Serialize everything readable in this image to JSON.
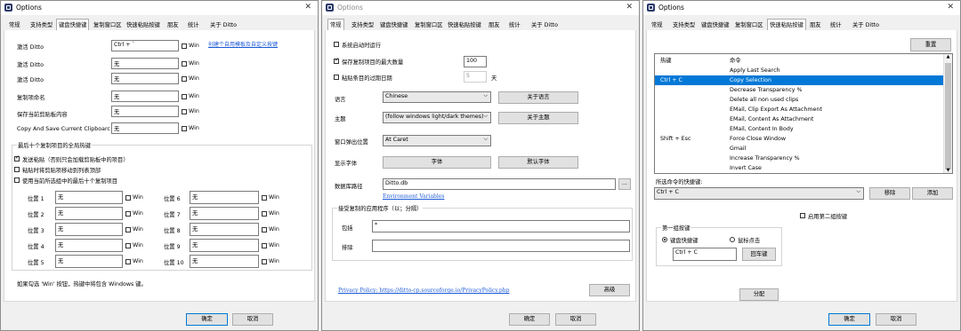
{
  "w1": {
    "title": "Options",
    "tabs": [
      "常规",
      "支持类型",
      "键盘快捷键",
      "复制窗口区",
      "快速粘贴按键",
      "朋友",
      "统计",
      "关于 Ditto"
    ],
    "top_hotkeys": [
      {
        "label": "激活 Ditto",
        "value": "Ctrl + `"
      },
      {
        "label": "激活 Ditto",
        "value": "无"
      },
      {
        "label": "激活 Ditto",
        "value": "无"
      },
      {
        "label": "复制项命名",
        "value": "无"
      },
      {
        "label": "保存当前剪贴板内容",
        "value": "无"
      },
      {
        "label": "Copy And Save Current Clipboarc",
        "value": "无"
      }
    ],
    "win_label": "Win",
    "link": "创建个自用模板及自定义按键",
    "group_title": "最后十个复制项目的全局热键",
    "checks": [
      {
        "label": "发送粘贴（否则只会加载剪贴板中的项目）",
        "checked": true
      },
      {
        "label": "粘贴时将剪贴项移动到列表顶部",
        "checked": false
      },
      {
        "label": "使用当前所选组中的最后十个复制项目",
        "checked": false
      }
    ],
    "positions_left": [
      {
        "label": "位置 1",
        "value": "无"
      },
      {
        "label": "位置 2",
        "value": "无"
      },
      {
        "label": "位置 3",
        "value": "无"
      },
      {
        "label": "位置 4",
        "value": "无"
      },
      {
        "label": "位置 5",
        "value": "无"
      }
    ],
    "positions_right": [
      {
        "label": "位置 6",
        "value": "无"
      },
      {
        "label": "位置 7",
        "value": "无"
      },
      {
        "label": "位置 8",
        "value": "无"
      },
      {
        "label": "位置 9",
        "value": "无"
      },
      {
        "label": "位置 10",
        "value": "无"
      }
    ],
    "note": "如果勾选 'Win' 按钮，热键中将包含 Windows 键。",
    "ok": "确定",
    "cancel": "取消"
  },
  "w2": {
    "title": "Options",
    "tabs": [
      "常规",
      "支持类型",
      "键盘快捷键",
      "复制窗口区",
      "快速粘贴按键",
      "朋友",
      "统计",
      "关于 Ditto"
    ],
    "startup": "系统启动时运行",
    "save_max": "保存复制项目的最大数量",
    "save_max_value": "100",
    "expire": "粘贴条目的过期日期",
    "expire_value": "5",
    "expire_unit": "天",
    "language_label": "语言",
    "language_value": "Chinese",
    "about_language": "关于语言",
    "theme_label": "主题",
    "theme_value": "(follow windows light/dark themes)",
    "about_theme": "关于主题",
    "popup_label": "窗口弹出位置",
    "popup_value": "At Caret",
    "font_label": "显示字体",
    "font_btn": "字体",
    "default_font_btn": "默认字体",
    "db_label": "数据库路径",
    "db_value": "Ditto.db",
    "db_browse": "...",
    "env_link": "Environment Variables",
    "accept_group": "接受复制的应用程序（以；分隔）",
    "include_label": "包括",
    "include_value": "*",
    "exclude_label": "排除",
    "exclude_value": "",
    "privacy": "Privacy Policy: https://ditto-cp.sourceforge.io/PrivacyPolicy.php",
    "advanced": "高级",
    "ok": "确定",
    "cancel": "取消"
  },
  "w3": {
    "title": "Options",
    "tabs": [
      "常规",
      "支持类型",
      "键盘快捷键",
      "复制窗口区",
      "快速粘贴按键",
      "朋友",
      "统计",
      "关于 Ditto"
    ],
    "reset": "重置",
    "col_hotkey": "热键",
    "col_command": "命令",
    "rows": [
      {
        "hotkey": "",
        "command": "Apply Last Search",
        "selected": false
      },
      {
        "hotkey": "Ctrl + C",
        "command": "Copy Selection",
        "selected": true
      },
      {
        "hotkey": "",
        "command": "Decrease Transparency %",
        "selected": false
      },
      {
        "hotkey": "",
        "command": "Delete all non used clips",
        "selected": false
      },
      {
        "hotkey": "",
        "command": "EMail, Clip Export As Attachment",
        "selected": false
      },
      {
        "hotkey": "",
        "command": "EMail, Content As Attachment",
        "selected": false
      },
      {
        "hotkey": "",
        "command": "EMail, Content In Body",
        "selected": false
      },
      {
        "hotkey": "Shift + Esc",
        "command": "Force Close Window",
        "selected": false
      },
      {
        "hotkey": "",
        "command": "Gmail",
        "selected": false
      },
      {
        "hotkey": "",
        "command": "Increase Transparency %",
        "selected": false
      },
      {
        "hotkey": "",
        "command": "Invert Case",
        "selected": false
      }
    ],
    "selected_label": "所选命令的快捷键:",
    "selected_value": "Ctrl + C",
    "remove": "移除",
    "add": "添加",
    "enable_second": "启用第二组按键",
    "first_group": "第一组按键",
    "radio_keyboard": "键盘快捷键",
    "radio_mouse": "鼠标点击",
    "key_value": "Ctrl + C",
    "enter_key": "回车键",
    "assign": "分配",
    "ok": "确定",
    "cancel": "取消"
  }
}
